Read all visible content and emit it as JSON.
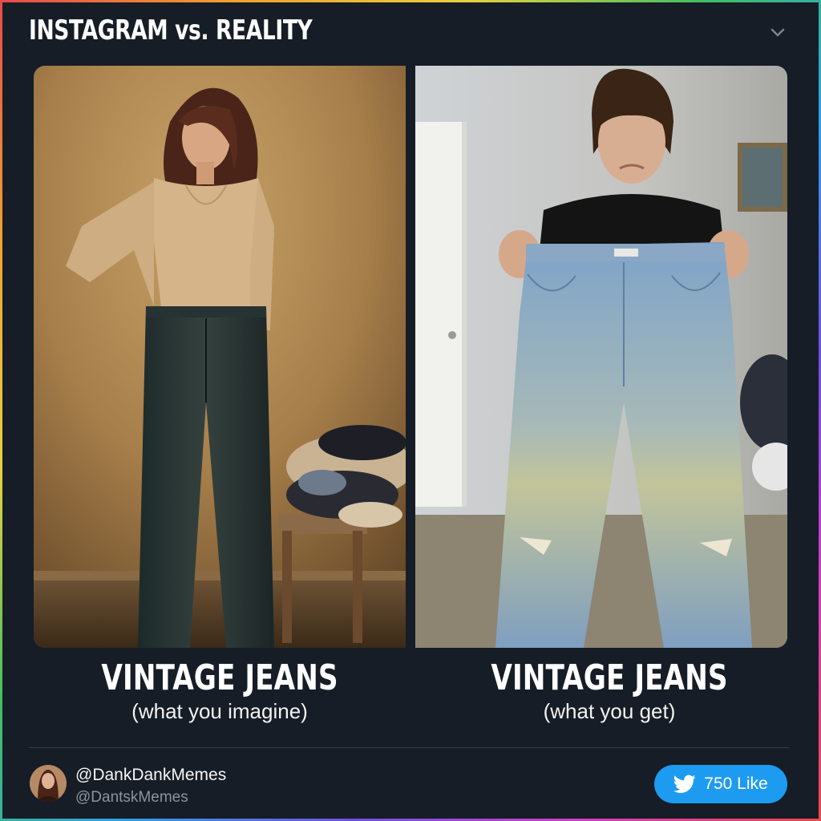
{
  "header": {
    "title": "INSTAGRAM vs. REALITY"
  },
  "panels": [
    {
      "caption_title": "VINTAGE JEANS",
      "caption_sub": "(what you imagine)"
    },
    {
      "caption_title": "VINTAGE JEANS",
      "caption_sub": "(what you get)"
    }
  ],
  "footer": {
    "handle": "@DankDankMemes",
    "subhandle": "@DantskMemes",
    "like_label": "750 Like"
  },
  "colors": {
    "background": "#161d26",
    "like_button": "#1d9bf0"
  },
  "icons": [
    "chevron-down-icon",
    "bird-icon",
    "avatar"
  ]
}
